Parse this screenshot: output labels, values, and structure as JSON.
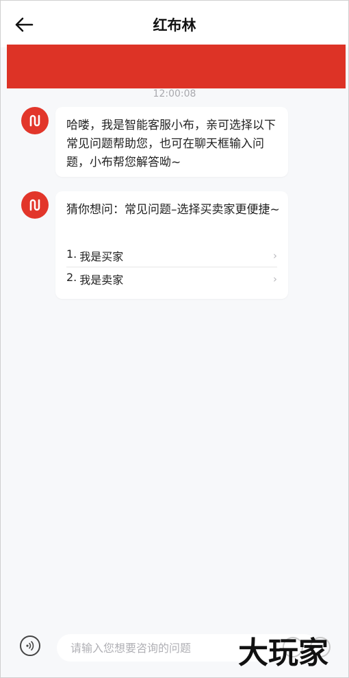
{
  "header": {
    "title": "红布林",
    "back_icon": "arrow-left-icon"
  },
  "chat": {
    "timestamp": "12:00:08",
    "messages": [
      {
        "avatar_icon": "brand-logo-icon",
        "text": "哈喽，我是智能客服小布，亲可选择以下常见问题帮助您，也可在聊天框输入问题，小布帮您解答呦~"
      },
      {
        "avatar_icon": "brand-logo-icon",
        "text": "猜你想问：常见问题–选择买卖家更便捷~",
        "options": [
          {
            "num": "1.",
            "label": "我是买家"
          },
          {
            "num": "2.",
            "label": "我是卖家"
          }
        ]
      }
    ]
  },
  "input": {
    "placeholder": "请输入您想要咨询的问题",
    "value": ""
  },
  "watermark": "大玩家",
  "colors": {
    "brand_red": "#dd3326",
    "background": "#f7f8fa"
  }
}
